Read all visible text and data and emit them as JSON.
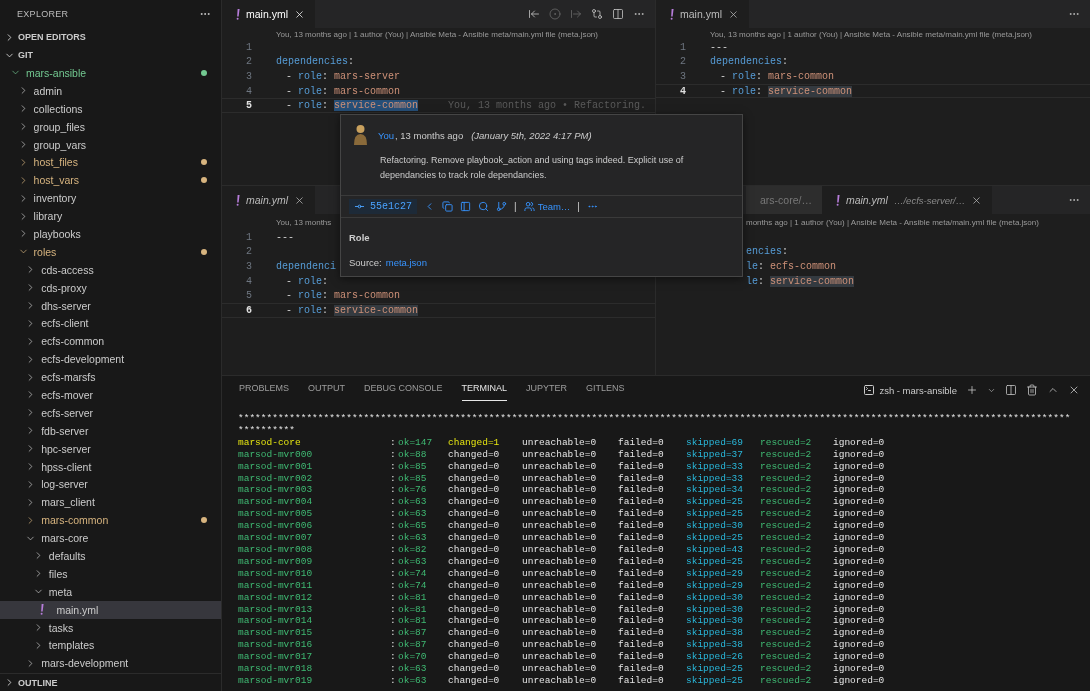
{
  "sidebar": {
    "title": "EXPLORER",
    "sections": [
      {
        "title": "OPEN EDITORS",
        "expanded": false
      },
      {
        "title": "GIT",
        "expanded": true,
        "tree": [
          {
            "label": "mars-ansible",
            "kind": "folder",
            "expanded": true,
            "selected": false,
            "color": "#73c991",
            "children": [
              {
                "label": "admin",
                "kind": "folder",
                "expanded": false,
                "selected": false
              },
              {
                "label": "collections",
                "kind": "folder",
                "expanded": false,
                "selected": false
              },
              {
                "label": "group_files",
                "kind": "folder",
                "expanded": false,
                "selected": false
              },
              {
                "label": "group_vars",
                "kind": "folder",
                "expanded": false,
                "selected": false
              },
              {
                "label": "host_files",
                "kind": "folder",
                "expanded": false,
                "selected": false,
                "color": "#d7b47f"
              },
              {
                "label": "host_vars",
                "kind": "folder",
                "expanded": false,
                "selected": false,
                "color": "#d7b47f"
              },
              {
                "label": "inventory",
                "kind": "folder",
                "expanded": false,
                "selected": false
              },
              {
                "label": "library",
                "kind": "folder",
                "expanded": false,
                "selected": false
              },
              {
                "label": "playbooks",
                "kind": "folder",
                "expanded": false,
                "selected": false
              },
              {
                "label": "roles",
                "kind": "folder",
                "expanded": true,
                "selected": false,
                "color": "#d7b47f",
                "children": [
                  {
                    "label": "cds-access",
                    "kind": "folder",
                    "expanded": false,
                    "selected": false
                  },
                  {
                    "label": "cds-proxy",
                    "kind": "folder",
                    "expanded": false,
                    "selected": false
                  },
                  {
                    "label": "dhs-server",
                    "kind": "folder",
                    "expanded": false,
                    "selected": false
                  },
                  {
                    "label": "ecfs-client",
                    "kind": "folder",
                    "expanded": false,
                    "selected": false
                  },
                  {
                    "label": "ecfs-common",
                    "kind": "folder",
                    "expanded": false,
                    "selected": false
                  },
                  {
                    "label": "ecfs-development",
                    "kind": "folder",
                    "expanded": false,
                    "selected": false
                  },
                  {
                    "label": "ecfs-marsfs",
                    "kind": "folder",
                    "expanded": false,
                    "selected": false
                  },
                  {
                    "label": "ecfs-mover",
                    "kind": "folder",
                    "expanded": false,
                    "selected": false
                  },
                  {
                    "label": "ecfs-server",
                    "kind": "folder",
                    "expanded": false,
                    "selected": false
                  },
                  {
                    "label": "fdb-server",
                    "kind": "folder",
                    "expanded": false,
                    "selected": false
                  },
                  {
                    "label": "hpc-server",
                    "kind": "folder",
                    "expanded": false,
                    "selected": false
                  },
                  {
                    "label": "hpss-client",
                    "kind": "folder",
                    "expanded": false,
                    "selected": false
                  },
                  {
                    "label": "log-server",
                    "kind": "folder",
                    "expanded": false,
                    "selected": false
                  },
                  {
                    "label": "mars_client",
                    "kind": "folder",
                    "expanded": false,
                    "selected": false
                  },
                  {
                    "label": "mars-common",
                    "kind": "folder",
                    "expanded": false,
                    "selected": false,
                    "color": "#d7b47f"
                  },
                  {
                    "label": "mars-core",
                    "kind": "folder",
                    "expanded": true,
                    "selected": false,
                    "children": [
                      {
                        "label": "defaults",
                        "kind": "folder",
                        "expanded": false,
                        "selected": false
                      },
                      {
                        "label": "files",
                        "kind": "folder",
                        "expanded": false,
                        "selected": false
                      },
                      {
                        "label": "meta",
                        "kind": "folder",
                        "expanded": true,
                        "selected": false,
                        "children": [
                          {
                            "label": "main.yml",
                            "kind": "file",
                            "selected": true
                          }
                        ]
                      },
                      {
                        "label": "tasks",
                        "kind": "folder",
                        "expanded": false,
                        "selected": false
                      },
                      {
                        "label": "templates",
                        "kind": "folder",
                        "expanded": false,
                        "selected": false
                      }
                    ]
                  },
                  {
                    "label": "mars-development",
                    "kind": "folder",
                    "expanded": false,
                    "selected": false
                  }
                ]
              }
            ]
          }
        ]
      },
      {
        "title": "OUTLINE",
        "expanded": false
      }
    ]
  },
  "editor_groups": [
    {
      "kind": "toolbar",
      "focused": true,
      "tabs": [
        {
          "label": "main.yml",
          "selected": true,
          "preview": false
        }
      ],
      "codelens": "You, 13 months ago | 1 author (You) | Ansible Meta - Ansible meta/main.yml file (meta.json)",
      "lines": [
        {
          "number": "1",
          "current": false
        },
        {
          "number": "2",
          "current": false,
          "tokens": [
            {
              "kind": "key",
              "text": "dependencies"
            },
            {
              "kind": "punct",
              "text": ":"
            }
          ]
        },
        {
          "number": "3",
          "current": false,
          "tokens": [
            {
              "kind": "dash",
              "text": "-"
            },
            {
              "kind": "key",
              "text": "role"
            },
            {
              "kind": "punct",
              "text": ":"
            },
            {
              "kind": "value",
              "text": "mars-server",
              "highlighted": false
            }
          ]
        },
        {
          "number": "4",
          "current": false,
          "tokens": [
            {
              "kind": "dash",
              "text": "-"
            },
            {
              "kind": "key",
              "text": "role"
            },
            {
              "kind": "punct",
              "text": ":"
            },
            {
              "kind": "value",
              "text": "mars-common",
              "highlighted": false
            }
          ]
        },
        {
          "number": "5",
          "current": true,
          "blame": "You, 13 months ago • Refactoring.",
          "tokens": [
            {
              "kind": "dash",
              "text": "-"
            },
            {
              "kind": "key",
              "text": "role"
            },
            {
              "kind": "punct",
              "text": ":"
            },
            {
              "kind": "value",
              "text": "service-common",
              "highlighted": true
            }
          ]
        }
      ]
    },
    {
      "kind": "more",
      "focused": false,
      "tabs": [
        {
          "label": "main.yml",
          "selected": true,
          "preview": false
        }
      ],
      "codelens": "You, 13 months ago | 1 author (You) | Ansible Meta - Ansible meta/main.yml file (meta.json)",
      "lines": [
        {
          "number": "1",
          "current": false,
          "tokens": [
            {
              "kind": "plain",
              "text": "---"
            }
          ]
        },
        {
          "number": "2",
          "current": false,
          "tokens": [
            {
              "kind": "key",
              "text": "dependencies"
            },
            {
              "kind": "punct",
              "text": ":"
            }
          ]
        },
        {
          "number": "3",
          "current": false,
          "tokens": [
            {
              "kind": "dash",
              "text": "-"
            },
            {
              "kind": "key",
              "text": "role"
            },
            {
              "kind": "punct",
              "text": ":"
            },
            {
              "kind": "value",
              "text": "mars-common",
              "highlighted": false
            }
          ]
        },
        {
          "number": "4",
          "current": true,
          "tokens": [
            {
              "kind": "dash",
              "text": "-"
            },
            {
              "kind": "key",
              "text": "role"
            },
            {
              "kind": "punct",
              "text": ":"
            },
            {
              "kind": "value",
              "text": "service-common",
              "highlighted": true
            }
          ]
        }
      ]
    },
    {
      "kind": "bare",
      "focused": false,
      "tabs": [
        {
          "label": "main.yml",
          "selected": true,
          "preview": true
        }
      ],
      "codelens": "You, 13 months",
      "lines": [
        {
          "number": "1",
          "current": false,
          "tokens": [
            {
              "kind": "plain",
              "text": "---"
            }
          ]
        },
        {
          "number": "2",
          "current": false
        },
        {
          "number": "3",
          "current": false,
          "tokens": [
            {
              "kind": "key",
              "text": "dependenci"
            }
          ]
        },
        {
          "number": "4",
          "current": false,
          "tokens": [
            {
              "kind": "dash",
              "text": "-"
            },
            {
              "kind": "key",
              "text": "role"
            },
            {
              "kind": "punct",
              "text": ":"
            }
          ]
        },
        {
          "number": "5",
          "current": false,
          "tokens": [
            {
              "kind": "dash",
              "text": "-"
            },
            {
              "kind": "key",
              "text": "role"
            },
            {
              "kind": "punct",
              "text": ":"
            },
            {
              "kind": "value",
              "text": "mars-common",
              "highlighted": false
            }
          ]
        },
        {
          "number": "6",
          "current": true,
          "tokens": [
            {
              "kind": "dash",
              "text": "-"
            },
            {
              "kind": "key",
              "text": "role"
            },
            {
              "kind": "punct",
              "text": ":"
            },
            {
              "kind": "value",
              "text": "service-common",
              "highlighted": true
            }
          ]
        }
      ]
    },
    {
      "kind": "offset",
      "focused": false,
      "tabs": [
        {
          "label": "ars-core/…",
          "selected": false,
          "preview": false
        },
        {
          "label": "main.yml",
          "description": "…/ecfs-server/…",
          "selected": true,
          "preview": true
        }
      ],
      "codelens": "months ago | 1 author (You) | Ansible Meta - Ansible meta/main.yml file (meta.json)",
      "lines": [
        {
          "tokens": [
            {
              "kind": "key",
              "text": "encies"
            },
            {
              "kind": "punct",
              "text": ":"
            }
          ]
        },
        {
          "tokens": [
            {
              "kind": "key",
              "text": "le"
            },
            {
              "kind": "punct",
              "text": ":"
            },
            {
              "kind": "value",
              "text": "ecfs-common",
              "highlighted": false
            }
          ]
        },
        {
          "tokens": [
            {
              "kind": "key",
              "text": "le"
            },
            {
              "kind": "punct",
              "text": ":"
            },
            {
              "kind": "value",
              "text": "service-common",
              "highlighted": true
            }
          ]
        }
      ]
    }
  ],
  "hover_card": {
    "author": "You",
    "relative_time": ", 13 months ago",
    "date": "(January 5th, 2022 4:17 PM)",
    "message": "Refactoring. Remove playbook_action and using tags indeed. Explicit use of dependancies to track role dependancies.",
    "commit": "55e1c27",
    "separators": [
      "|",
      "|"
    ],
    "team": "Team…",
    "section_title": "Role",
    "source_label": "Source:",
    "source_link": "meta.json"
  },
  "panel": {
    "tabs": [
      {
        "label": "PROBLEMS",
        "selected": false
      },
      {
        "label": "OUTPUT",
        "selected": false
      },
      {
        "label": "DEBUG CONSOLE",
        "selected": false
      },
      {
        "label": "TERMINAL",
        "selected": true
      },
      {
        "label": "JUPYTER",
        "selected": false
      },
      {
        "label": "GITLENS",
        "selected": false
      }
    ],
    "terminal_name": "zsh - mars-ansible",
    "banner": [
      "**************************************************************************************************************************************************",
      "**********"
    ],
    "rows": [
      {
        "has_changes": true,
        "host": "marsod-core",
        "colon": ":",
        "ok": "ok=147",
        "changed": "changed=1",
        "unreachable": "unreachable=0",
        "failed": "failed=0",
        "skipped": "skipped=69",
        "rescued": "rescued=2",
        "ignored": "ignored=0"
      },
      {
        "has_changes": false,
        "host": "marsod-mvr000",
        "colon": ":",
        "ok": "ok=88",
        "changed": "changed=0",
        "unreachable": "unreachable=0",
        "failed": "failed=0",
        "skipped": "skipped=37",
        "rescued": "rescued=2",
        "ignored": "ignored=0"
      },
      {
        "has_changes": false,
        "host": "marsod-mvr001",
        "colon": ":",
        "ok": "ok=85",
        "changed": "changed=0",
        "unreachable": "unreachable=0",
        "failed": "failed=0",
        "skipped": "skipped=33",
        "rescued": "rescued=2",
        "ignored": "ignored=0"
      },
      {
        "has_changes": false,
        "host": "marsod-mvr002",
        "colon": ":",
        "ok": "ok=85",
        "changed": "changed=0",
        "unreachable": "unreachable=0",
        "failed": "failed=0",
        "skipped": "skipped=33",
        "rescued": "rescued=2",
        "ignored": "ignored=0"
      },
      {
        "has_changes": false,
        "host": "marsod-mvr003",
        "colon": ":",
        "ok": "ok=76",
        "changed": "changed=0",
        "unreachable": "unreachable=0",
        "failed": "failed=0",
        "skipped": "skipped=34",
        "rescued": "rescued=2",
        "ignored": "ignored=0"
      },
      {
        "has_changes": false,
        "host": "marsod-mvr004",
        "colon": ":",
        "ok": "ok=63",
        "changed": "changed=0",
        "unreachable": "unreachable=0",
        "failed": "failed=0",
        "skipped": "skipped=25",
        "rescued": "rescued=2",
        "ignored": "ignored=0"
      },
      {
        "has_changes": false,
        "host": "marsod-mvr005",
        "colon": ":",
        "ok": "ok=63",
        "changed": "changed=0",
        "unreachable": "unreachable=0",
        "failed": "failed=0",
        "skipped": "skipped=25",
        "rescued": "rescued=2",
        "ignored": "ignored=0"
      },
      {
        "has_changes": false,
        "host": "marsod-mvr006",
        "colon": ":",
        "ok": "ok=65",
        "changed": "changed=0",
        "unreachable": "unreachable=0",
        "failed": "failed=0",
        "skipped": "skipped=30",
        "rescued": "rescued=2",
        "ignored": "ignored=0"
      },
      {
        "has_changes": false,
        "host": "marsod-mvr007",
        "colon": ":",
        "ok": "ok=63",
        "changed": "changed=0",
        "unreachable": "unreachable=0",
        "failed": "failed=0",
        "skipped": "skipped=25",
        "rescued": "rescued=2",
        "ignored": "ignored=0"
      },
      {
        "has_changes": false,
        "host": "marsod-mvr008",
        "colon": ":",
        "ok": "ok=82",
        "changed": "changed=0",
        "unreachable": "unreachable=0",
        "failed": "failed=0",
        "skipped": "skipped=43",
        "rescued": "rescued=2",
        "ignored": "ignored=0"
      },
      {
        "has_changes": false,
        "host": "marsod-mvr009",
        "colon": ":",
        "ok": "ok=63",
        "changed": "changed=0",
        "unreachable": "unreachable=0",
        "failed": "failed=0",
        "skipped": "skipped=25",
        "rescued": "rescued=2",
        "ignored": "ignored=0"
      },
      {
        "has_changes": false,
        "host": "marsod-mvr010",
        "colon": ":",
        "ok": "ok=74",
        "changed": "changed=0",
        "unreachable": "unreachable=0",
        "failed": "failed=0",
        "skipped": "skipped=29",
        "rescued": "rescued=2",
        "ignored": "ignored=0"
      },
      {
        "has_changes": false,
        "host": "marsod-mvr011",
        "colon": ":",
        "ok": "ok=74",
        "changed": "changed=0",
        "unreachable": "unreachable=0",
        "failed": "failed=0",
        "skipped": "skipped=29",
        "rescued": "rescued=2",
        "ignored": "ignored=0"
      },
      {
        "has_changes": false,
        "host": "marsod-mvr012",
        "colon": ":",
        "ok": "ok=81",
        "changed": "changed=0",
        "unreachable": "unreachable=0",
        "failed": "failed=0",
        "skipped": "skipped=30",
        "rescued": "rescued=2",
        "ignored": "ignored=0"
      },
      {
        "has_changes": false,
        "host": "marsod-mvr013",
        "colon": ":",
        "ok": "ok=81",
        "changed": "changed=0",
        "unreachable": "unreachable=0",
        "failed": "failed=0",
        "skipped": "skipped=30",
        "rescued": "rescued=2",
        "ignored": "ignored=0"
      },
      {
        "has_changes": false,
        "host": "marsod-mvr014",
        "colon": ":",
        "ok": "ok=81",
        "changed": "changed=0",
        "unreachable": "unreachable=0",
        "failed": "failed=0",
        "skipped": "skipped=30",
        "rescued": "rescued=2",
        "ignored": "ignored=0"
      },
      {
        "has_changes": false,
        "host": "marsod-mvr015",
        "colon": ":",
        "ok": "ok=87",
        "changed": "changed=0",
        "unreachable": "unreachable=0",
        "failed": "failed=0",
        "skipped": "skipped=38",
        "rescued": "rescued=2",
        "ignored": "ignored=0"
      },
      {
        "has_changes": false,
        "host": "marsod-mvr016",
        "colon": ":",
        "ok": "ok=87",
        "changed": "changed=0",
        "unreachable": "unreachable=0",
        "failed": "failed=0",
        "skipped": "skipped=38",
        "rescued": "rescued=2",
        "ignored": "ignored=0"
      },
      {
        "has_changes": false,
        "host": "marsod-mvr017",
        "colon": ":",
        "ok": "ok=70",
        "changed": "changed=0",
        "unreachable": "unreachable=0",
        "failed": "failed=0",
        "skipped": "skipped=26",
        "rescued": "rescued=2",
        "ignored": "ignored=0"
      },
      {
        "has_changes": false,
        "host": "marsod-mvr018",
        "colon": ":",
        "ok": "ok=63",
        "changed": "changed=0",
        "unreachable": "unreachable=0",
        "failed": "failed=0",
        "skipped": "skipped=25",
        "rescued": "rescued=2",
        "ignored": "ignored=0"
      },
      {
        "has_changes": false,
        "host": "marsod-mvr019",
        "colon": ":",
        "ok": "ok=63",
        "changed": "changed=0",
        "unreachable": "unreachable=0",
        "failed": "failed=0",
        "skipped": "skipped=25",
        "rescued": "rescued=2",
        "ignored": "ignored=0"
      }
    ]
  }
}
